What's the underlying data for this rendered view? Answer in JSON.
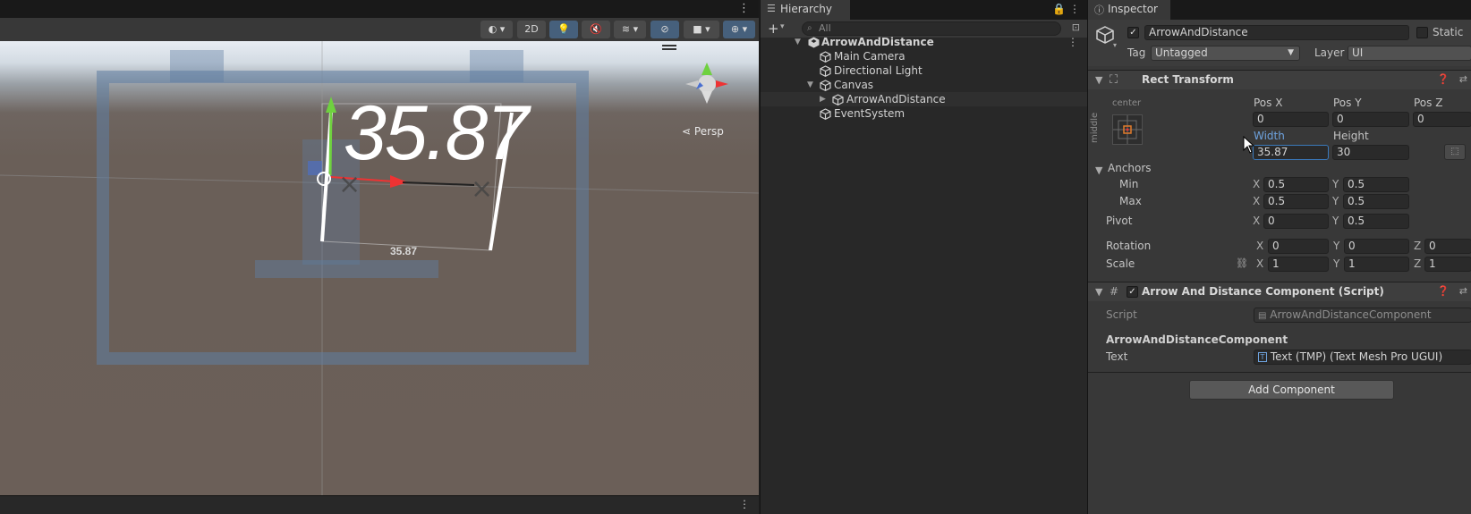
{
  "scene": {
    "toolbar": {
      "btn_2d": "2D"
    },
    "persp_label": "Persp",
    "big_text": "35.87",
    "dimension_label": "35.87"
  },
  "hierarchy": {
    "tab_label": "Hierarchy",
    "search_placeholder": "All",
    "items": [
      {
        "label": "ArrowAndDistance"
      },
      {
        "label": "Main Camera"
      },
      {
        "label": "Directional Light"
      },
      {
        "label": "Canvas"
      },
      {
        "label": "ArrowAndDistance"
      },
      {
        "label": "EventSystem"
      }
    ]
  },
  "inspector": {
    "tab_label": "Inspector",
    "object_name": "ArrowAndDistance",
    "static_label": "Static",
    "tag_label": "Tag",
    "tag_value": "Untagged",
    "layer_label": "Layer",
    "layer_value": "UI",
    "rect_transform": {
      "title": "Rect Transform",
      "anchor_preset_h": "center",
      "anchor_preset_v": "middle",
      "pos_x_label": "Pos X",
      "pos_y_label": "Pos Y",
      "pos_z_label": "Pos Z",
      "pos_x": "0",
      "pos_y": "0",
      "pos_z": "0",
      "width_label": "Width",
      "height_label": "Height",
      "width": "35.87",
      "height": "30",
      "anchors_label": "Anchors",
      "min_label": "Min",
      "max_label": "Max",
      "min_x": "0.5",
      "min_y": "0.5",
      "max_x": "0.5",
      "max_y": "0.5",
      "pivot_label": "Pivot",
      "pivot_x": "0",
      "pivot_y": "0.5",
      "rotation_label": "Rotation",
      "rot_x": "0",
      "rot_y": "0",
      "rot_z": "0",
      "scale_label": "Scale",
      "scale_x": "1",
      "scale_y": "1",
      "scale_z": "1",
      "axis_x": "X",
      "axis_y": "Y",
      "axis_z": "Z"
    },
    "script_component": {
      "title": "Arrow And Distance Component (Script)",
      "script_label": "Script",
      "script_value": "ArrowAndDistanceComponent",
      "subheader": "ArrowAndDistanceComponent",
      "text_label": "Text",
      "text_value": "Text (TMP) (Text Mesh Pro UGUI)"
    },
    "add_component": "Add Component"
  },
  "colors": {
    "accent_blue": "#3a79bb",
    "panel_bg": "#383838",
    "hierarchy_bg": "#282828",
    "toolbar_active": "#46607c"
  }
}
